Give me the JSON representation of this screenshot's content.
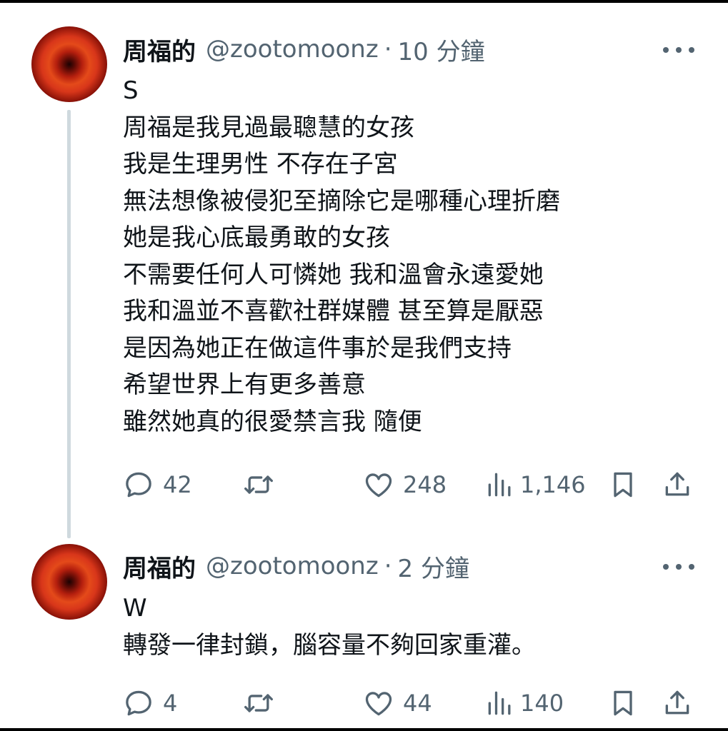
{
  "tweets": [
    {
      "display_name": "周福的",
      "handle": "@zootomoonz",
      "separator": "·",
      "time": "10 分鐘",
      "lines": [
        "S",
        "周福是我見過最聰慧的女孩",
        "我是生理男性 不存在子宮",
        "無法想像被侵犯至摘除它是哪種心理折磨",
        "她是我心底最勇敢的女孩",
        "不需要任何人可憐她 我和溫會永遠愛她",
        "我和溫並不喜歡社群媒體 甚至算是厭惡",
        "是因為她正在做這件事於是我們支持",
        "希望世界上有更多善意",
        "雖然她真的很愛禁言我 隨便"
      ],
      "replies": "42",
      "likes": "248",
      "views": "1,146"
    },
    {
      "display_name": "周福的",
      "handle": "@zootomoonz",
      "separator": "·",
      "time": "2 分鐘",
      "lines": [
        "W",
        "轉發一律封鎖，腦容量不夠回家重灌。"
      ],
      "replies": "4",
      "likes": "44",
      "views": "140"
    }
  ],
  "icons": {
    "more": "more-horizontal-icon",
    "reply": "reply-bubble-icon",
    "retweet": "retweet-icon",
    "like": "heart-icon",
    "views": "analytics-bars-icon",
    "bookmark": "bookmark-icon",
    "share": "share-upload-icon"
  },
  "colors": {
    "text": "#0f1419",
    "secondary": "#536471",
    "thread_line": "#cfd9de",
    "background": "#ffffff",
    "frame": "#000000"
  }
}
